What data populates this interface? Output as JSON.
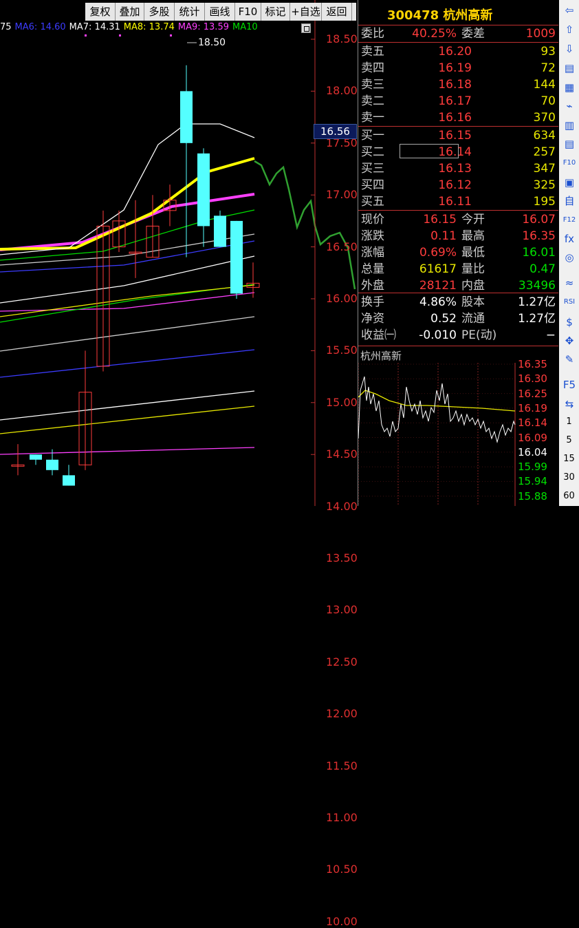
{
  "toolbar": [
    "复权",
    "叠加",
    "多股",
    "统计",
    "画线",
    "F10",
    "标记",
    "+自选",
    "返回"
  ],
  "ma_legend": [
    {
      "text": "75",
      "color": "#ffffff"
    },
    {
      "text": "MA6: 14.60",
      "color": "#3c3cff"
    },
    {
      "text": "MA7: 14.31",
      "color": "#ffffff"
    },
    {
      "text": "MA8: 13.74",
      "color": "#ffff00"
    },
    {
      "text": "MA9: 13.59",
      "color": "#ff40ff"
    },
    {
      "text": "MA10",
      "color": "#00e000"
    }
  ],
  "price_axis": [
    "18.50",
    "18.00",
    "17.50",
    "17.00",
    "16.50",
    "16.00",
    "15.50",
    "15.00",
    "14.50",
    "14.00",
    "13.50",
    "13.00",
    "12.50",
    "12.00",
    "11.50",
    "11.00",
    "10.50",
    "10.00"
  ],
  "high_annotation": "18.50",
  "current_price_tag": "16.56",
  "quote": {
    "title": "300478 杭州高新",
    "webi": {
      "label": "委比",
      "value": "40.25%",
      "label2": "委差",
      "value2": "1009"
    },
    "asks": [
      {
        "label": "卖五",
        "price": "16.20",
        "vol": "93"
      },
      {
        "label": "卖四",
        "price": "16.19",
        "vol": "72"
      },
      {
        "label": "卖三",
        "price": "16.18",
        "vol": "144"
      },
      {
        "label": "卖二",
        "price": "16.17",
        "vol": "70"
      },
      {
        "label": "卖一",
        "price": "16.16",
        "vol": "370"
      }
    ],
    "bids": [
      {
        "label": "买一",
        "price": "16.15",
        "vol": "634"
      },
      {
        "label": "买二",
        "price": "16.14",
        "vol": "257"
      },
      {
        "label": "买三",
        "price": "16.13",
        "vol": "347"
      },
      {
        "label": "买四",
        "price": "16.12",
        "vol": "325"
      },
      {
        "label": "买五",
        "price": "16.11",
        "vol": "195"
      }
    ],
    "stats1": [
      {
        "l1": "现价",
        "v1": "16.15",
        "c1": "red",
        "l2": "今开",
        "v2": "16.07",
        "c2": "red"
      },
      {
        "l1": "涨跌",
        "v1": "0.11",
        "c1": "red",
        "l2": "最高",
        "v2": "16.35",
        "c2": "red"
      },
      {
        "l1": "涨幅",
        "v1": "0.69%",
        "c1": "red",
        "l2": "最低",
        "v2": "16.01",
        "c2": "green"
      },
      {
        "l1": "总量",
        "v1": "61617",
        "c1": "yellow",
        "l2": "量比",
        "v2": "0.47",
        "c2": "green"
      },
      {
        "l1": "外盘",
        "v1": "28121",
        "c1": "red",
        "l2": "内盘",
        "v2": "33496",
        "c2": "green"
      }
    ],
    "stats2": [
      {
        "l1": "换手",
        "v1": "4.86%",
        "l2": "股本",
        "v2": "1.27亿"
      },
      {
        "l1": "净资",
        "v1": "0.52",
        "l2": "流通",
        "v2": "1.27亿"
      },
      {
        "l1": "收益㈠",
        "v1": "-0.010",
        "l2": "PE(动)",
        "v2": "−"
      }
    ],
    "mini_title": "杭州高新",
    "mini_axis": [
      {
        "v": "16.35",
        "c": "red"
      },
      {
        "v": "16.30",
        "c": "red"
      },
      {
        "v": "16.25",
        "c": "red"
      },
      {
        "v": "16.19",
        "c": "red"
      },
      {
        "v": "16.14",
        "c": "red"
      },
      {
        "v": "16.09",
        "c": "red"
      },
      {
        "v": "16.04",
        "c": "white"
      },
      {
        "v": "15.99",
        "c": "green"
      },
      {
        "v": "15.94",
        "c": "green"
      },
      {
        "v": "15.88",
        "c": "green"
      }
    ]
  },
  "iconbar": {
    "icons": [
      {
        "name": "back-arrow-icon",
        "glyph": "⇦"
      },
      {
        "name": "up-arrow-icon",
        "glyph": "⇧"
      },
      {
        "name": "down-arrow-icon",
        "glyph": "⇩"
      },
      {
        "name": "report-icon",
        "glyph": "▤"
      },
      {
        "name": "grid-icon",
        "glyph": "▦"
      },
      {
        "name": "line-chart-icon",
        "glyph": "⌁"
      },
      {
        "name": "candle-chart-icon",
        "glyph": "▥"
      },
      {
        "name": "news-icon",
        "glyph": "▤"
      },
      {
        "name": "f10-icon",
        "glyph": "F10"
      },
      {
        "name": "notes-icon",
        "glyph": "▣"
      },
      {
        "name": "self-select-icon",
        "glyph": "自"
      },
      {
        "name": "f12-icon",
        "glyph": "F12"
      },
      {
        "name": "formula-icon",
        "glyph": "fx"
      },
      {
        "name": "refresh-icon",
        "glyph": "◎"
      },
      {
        "name": "indicator-icon",
        "glyph": "≈"
      },
      {
        "name": "rsi-icon",
        "glyph": "RSI"
      },
      {
        "name": "dollar-icon",
        "glyph": "$"
      },
      {
        "name": "move-icon",
        "glyph": "✥"
      },
      {
        "name": "pencil-icon",
        "glyph": "✎"
      },
      {
        "name": "f5-icon",
        "glyph": "F5"
      },
      {
        "name": "export-icon",
        "glyph": "⇆"
      }
    ],
    "periods": [
      "1",
      "5",
      "15",
      "30",
      "60"
    ]
  }
}
